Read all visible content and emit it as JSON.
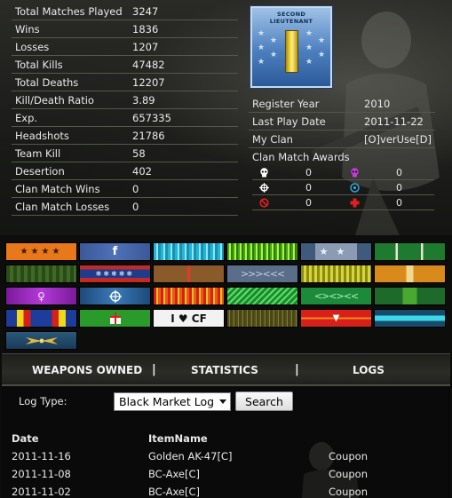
{
  "stats": [
    {
      "label": "Total Matches Played",
      "value": "3247"
    },
    {
      "label": "Wins",
      "value": "1836"
    },
    {
      "label": "Losses",
      "value": "1207"
    },
    {
      "label": "Total Kills",
      "value": "47482"
    },
    {
      "label": "Total Deaths",
      "value": "12207"
    },
    {
      "label": "Kill/Death Ratio",
      "value": "3.89"
    },
    {
      "label": "Exp.",
      "value": "657335"
    },
    {
      "label": "Headshots",
      "value": "21786"
    },
    {
      "label": "Team Kill",
      "value": "58"
    },
    {
      "label": "Desertion",
      "value": "402"
    },
    {
      "label": "Clan Match Wins",
      "value": "0"
    },
    {
      "label": "Clan Match Losses",
      "value": "0"
    }
  ],
  "rank": {
    "title_line1": "SECOND",
    "title_line2": "LIEUTENANT",
    "icon": "rank-insignia-icon"
  },
  "info": [
    {
      "label": "Register Year",
      "value": "2010"
    },
    {
      "label": "Last Play Date",
      "value": "2011-11-22"
    },
    {
      "label": "My Clan",
      "value": "[O]verUse[D]"
    }
  ],
  "clan_awards": {
    "label": "Clan Match Awards",
    "rows": [
      [
        {
          "icon": "skull-icon",
          "color": "#ffffff",
          "count": "0"
        },
        {
          "icon": "purple-skull-icon",
          "color": "#c23cd8",
          "count": "0"
        }
      ],
      [
        {
          "icon": "crosshair-icon",
          "color": "#ffffff",
          "count": "0"
        },
        {
          "icon": "target-icon",
          "color": "#2fa8e0",
          "count": "0"
        }
      ],
      [
        {
          "icon": "no-symbol-icon",
          "color": "#e02020",
          "count": "0"
        },
        {
          "icon": "medic-cross-icon",
          "color": "#e02020",
          "count": "0"
        }
      ]
    ]
  },
  "ribbons": {
    "love_cf_text": "I ♥ CF"
  },
  "tabs": {
    "weapons": "WEAPONS OWNED",
    "statistics": "STATISTICS",
    "logs": "LOGS",
    "separator": "|"
  },
  "log_controls": {
    "label": "Log Type:",
    "selected": "Black Market Log",
    "search": "Search"
  },
  "log_table": {
    "headers": {
      "date": "Date",
      "item": "ItemName"
    },
    "rows": [
      {
        "date": "2011-11-16",
        "item": "Golden AK-47[C]",
        "type": "Coupon"
      },
      {
        "date": "2011-11-08",
        "item": "BC-Axe[C]",
        "type": "Coupon"
      },
      {
        "date": "2011-11-02",
        "item": "BC-Axe[C]",
        "type": "Coupon"
      }
    ]
  }
}
